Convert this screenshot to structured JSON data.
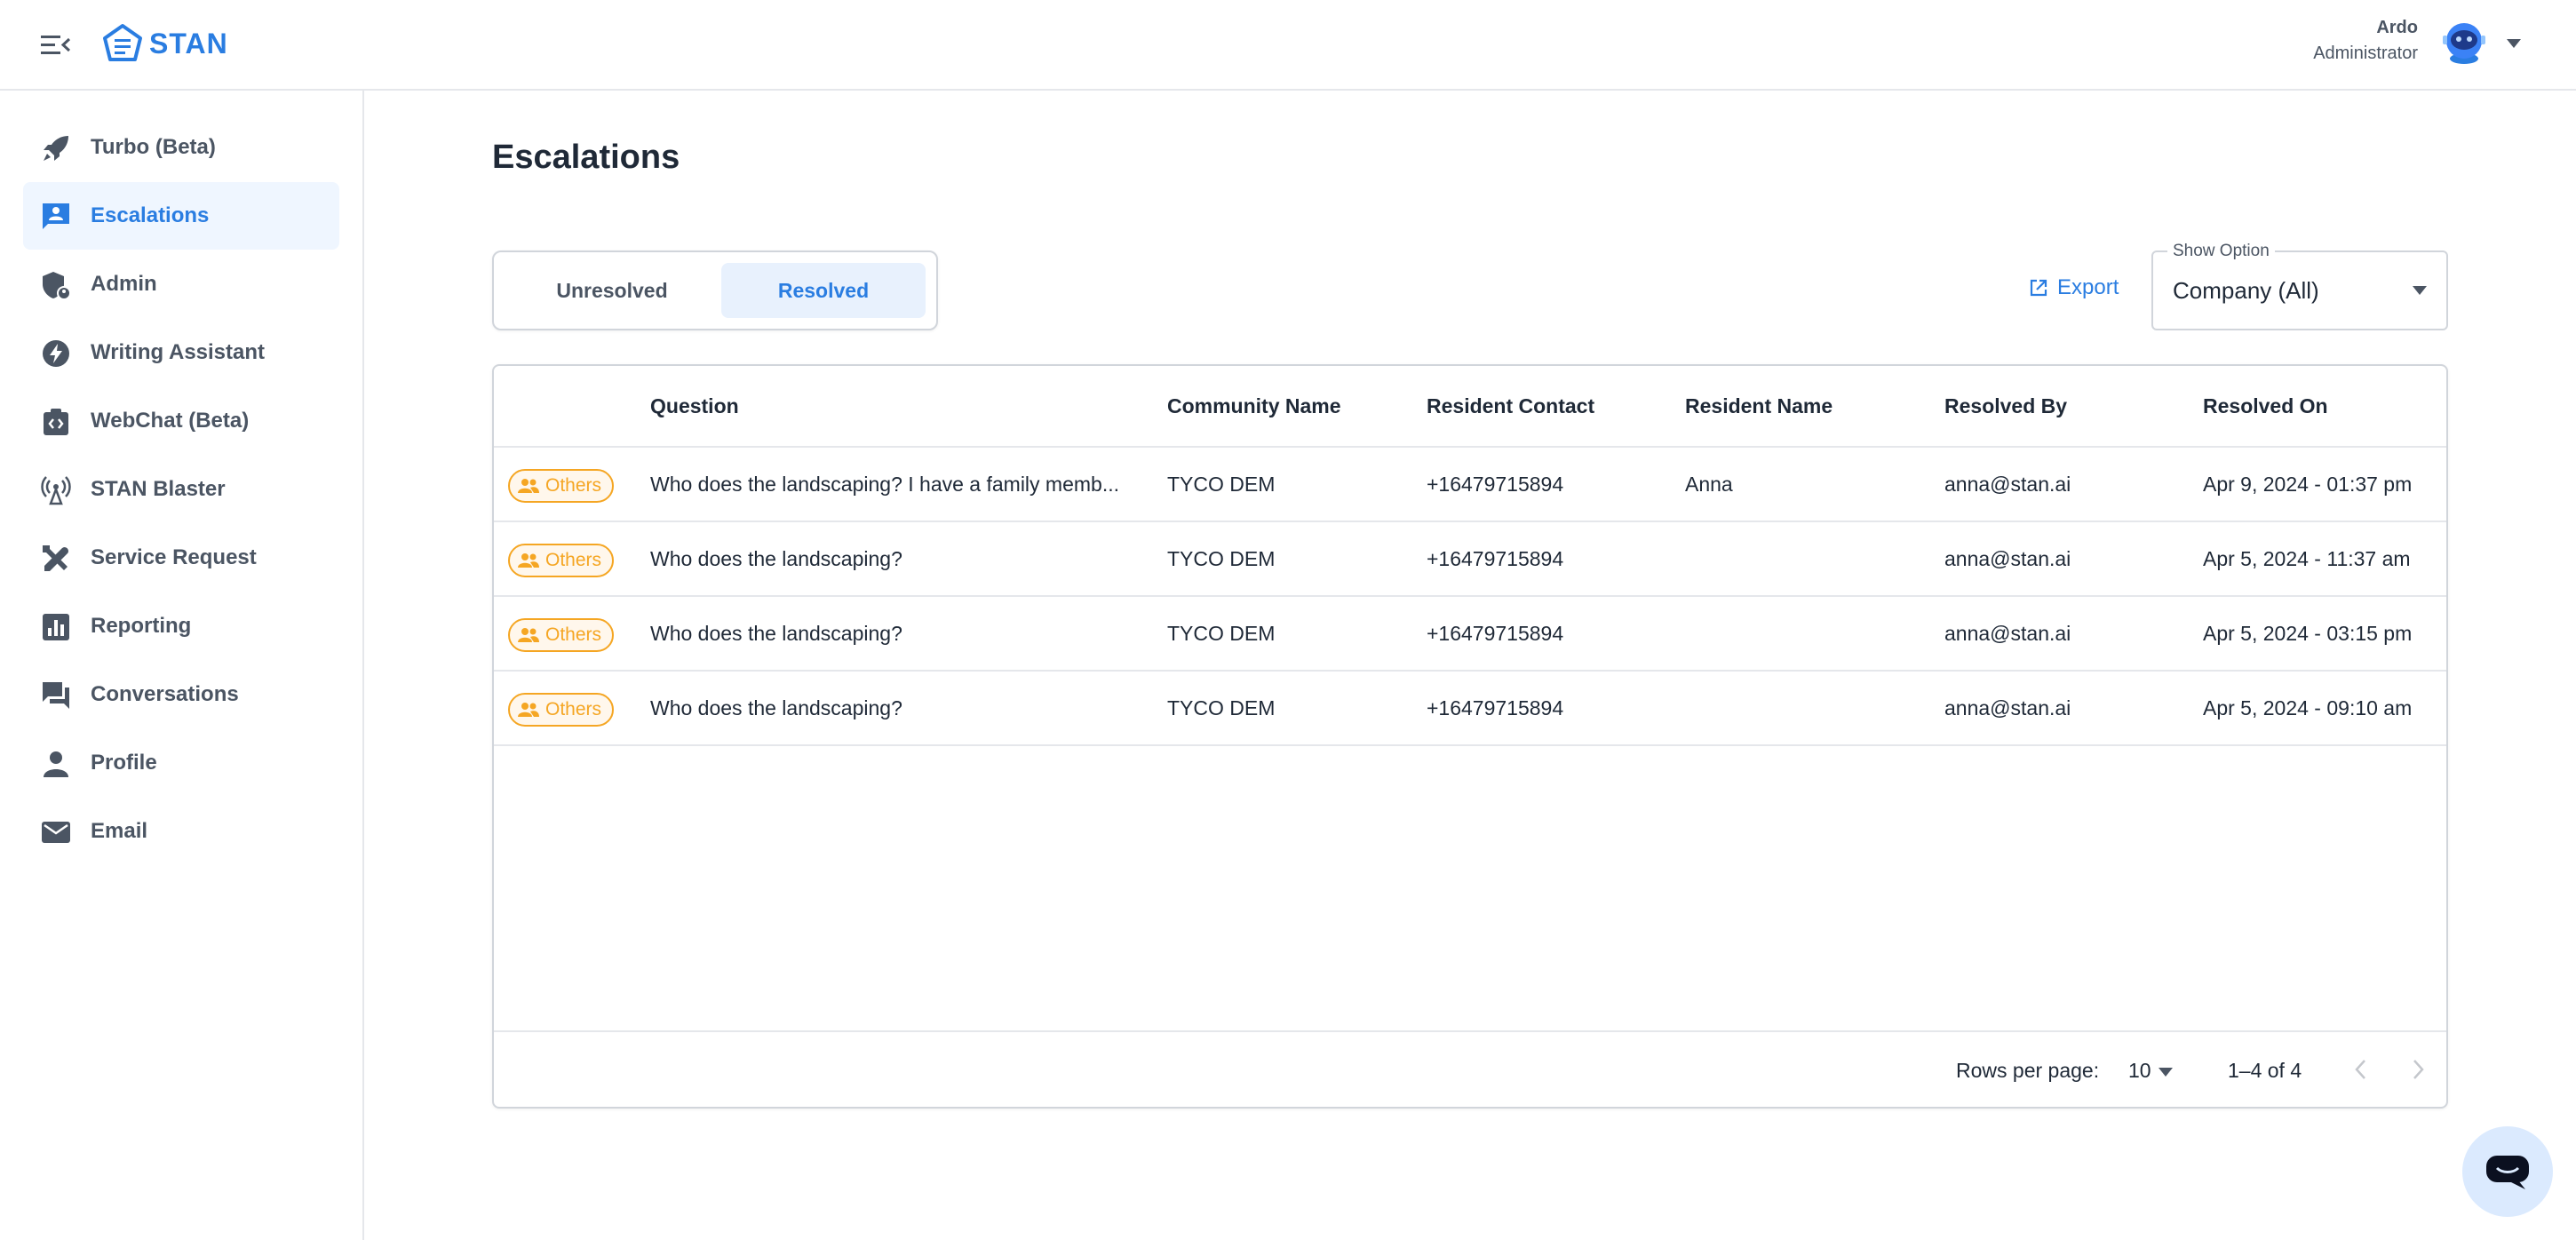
{
  "app": {
    "logo_text": "STAN"
  },
  "user": {
    "name": "Ardo",
    "role": "Administrator"
  },
  "sidebar": {
    "items": [
      {
        "label": "Turbo (Beta)",
        "icon": "rocket-icon",
        "active": false
      },
      {
        "label": "Escalations",
        "icon": "escalation-icon",
        "active": true
      },
      {
        "label": "Admin",
        "icon": "admin-shield-icon",
        "active": false
      },
      {
        "label": "Writing Assistant",
        "icon": "lightning-icon",
        "active": false
      },
      {
        "label": "WebChat (Beta)",
        "icon": "webchat-icon",
        "active": false
      },
      {
        "label": "STAN Blaster",
        "icon": "broadcast-icon",
        "active": false
      },
      {
        "label": "Service Request",
        "icon": "tools-icon",
        "active": false
      },
      {
        "label": "Reporting",
        "icon": "reporting-icon",
        "active": false
      },
      {
        "label": "Conversations",
        "icon": "chat-bubbles-icon",
        "active": false
      },
      {
        "label": "Profile",
        "icon": "person-icon",
        "active": false
      },
      {
        "label": "Email",
        "icon": "mail-icon",
        "active": false
      }
    ]
  },
  "main": {
    "title": "Escalations",
    "tabs": [
      {
        "label": "Unresolved",
        "active": false
      },
      {
        "label": "Resolved",
        "active": true
      }
    ],
    "export_label": "Export",
    "show_option": {
      "legend": "Show Option",
      "value": "Company (All)"
    }
  },
  "table": {
    "columns": [
      "Question",
      "Community Name",
      "Resident Contact",
      "Resident Name",
      "Resolved By",
      "Resolved On"
    ],
    "rows": [
      {
        "badge": "Others",
        "question": "Who does the landscaping? I have a family memb...",
        "community": "TYCO DEM",
        "contact": "+16479715894",
        "resident": "Anna",
        "resolved_by": "anna@stan.ai",
        "resolved_on": "Apr 9, 2024 - 01:37 pm"
      },
      {
        "badge": "Others",
        "question": "Who does the landscaping?",
        "community": "TYCO DEM",
        "contact": "+16479715894",
        "resident": "",
        "resolved_by": "anna@stan.ai",
        "resolved_on": "Apr 5, 2024 - 11:37 am"
      },
      {
        "badge": "Others",
        "question": "Who does the landscaping?",
        "community": "TYCO DEM",
        "contact": "+16479715894",
        "resident": "",
        "resolved_by": "anna@stan.ai",
        "resolved_on": "Apr 5, 2024 - 03:15 pm"
      },
      {
        "badge": "Others",
        "question": "Who does the landscaping?",
        "community": "TYCO DEM",
        "contact": "+16479715894",
        "resident": "",
        "resolved_by": "anna@stan.ai",
        "resolved_on": "Apr 5, 2024 - 09:10 am"
      }
    ],
    "pagination": {
      "rows_per_page_label": "Rows per page:",
      "rows_per_page": "10",
      "range": "1–4 of 4"
    }
  },
  "colors": {
    "accent": "#2a7de1",
    "badge": "#f5a623",
    "text": "#1f2937",
    "muted": "#4b5563"
  }
}
